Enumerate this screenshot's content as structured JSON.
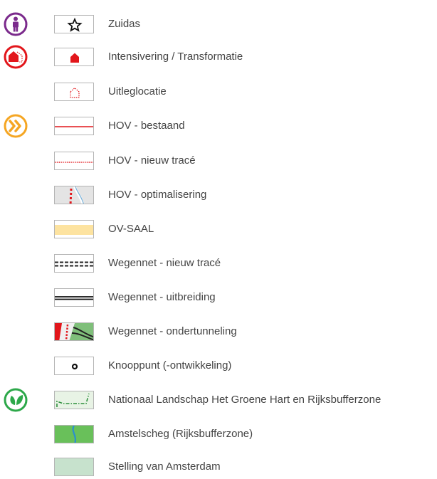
{
  "legend": {
    "items": [
      {
        "label": "Zuidas",
        "swatch_icon": "star-icon",
        "category_icon": "person-icon",
        "category_color": "#7b2a8c"
      },
      {
        "label": "Intensivering / Transformatie",
        "swatch_icon": "house-filled-icon",
        "category_icon": "house-circle-icon",
        "category_color": "#e2161b"
      },
      {
        "label": "Uitleglocatie",
        "swatch_icon": "house-dotted-icon"
      },
      {
        "label": "HOV - bestaand",
        "swatch_icon": "red-line-icon",
        "category_icon": "double-chevron-icon",
        "category_color": "#f5a623"
      },
      {
        "label": "HOV - nieuw tracé",
        "swatch_icon": "red-dotted-line-icon"
      },
      {
        "label": "HOV - optimalisering",
        "swatch_icon": "hov-map-icon"
      },
      {
        "label": "OV-SAAL",
        "swatch_icon": "yellow-band-icon"
      },
      {
        "label": "Wegennet - nieuw tracé",
        "swatch_icon": "dashed-road-icon"
      },
      {
        "label": "Wegennet - uitbreiding",
        "swatch_icon": "double-line-road-icon"
      },
      {
        "label": "Wegennet - ondertunneling",
        "swatch_icon": "tunnel-map-icon"
      },
      {
        "label": "Knooppunt (-ontwikkeling)",
        "swatch_icon": "node-circle-icon"
      },
      {
        "label": "Nationaal Landschap Het Groene Hart en Rijksbufferzone",
        "swatch_icon": "green-dashdot-icon",
        "category_icon": "leaf-circle-icon",
        "category_color": "#2da84a"
      },
      {
        "label": "Amstelscheg (Rijksbufferzone)",
        "swatch_icon": "green-river-icon"
      },
      {
        "label": "Stelling van Amsterdam",
        "swatch_icon": "pale-green-icon"
      }
    ]
  }
}
